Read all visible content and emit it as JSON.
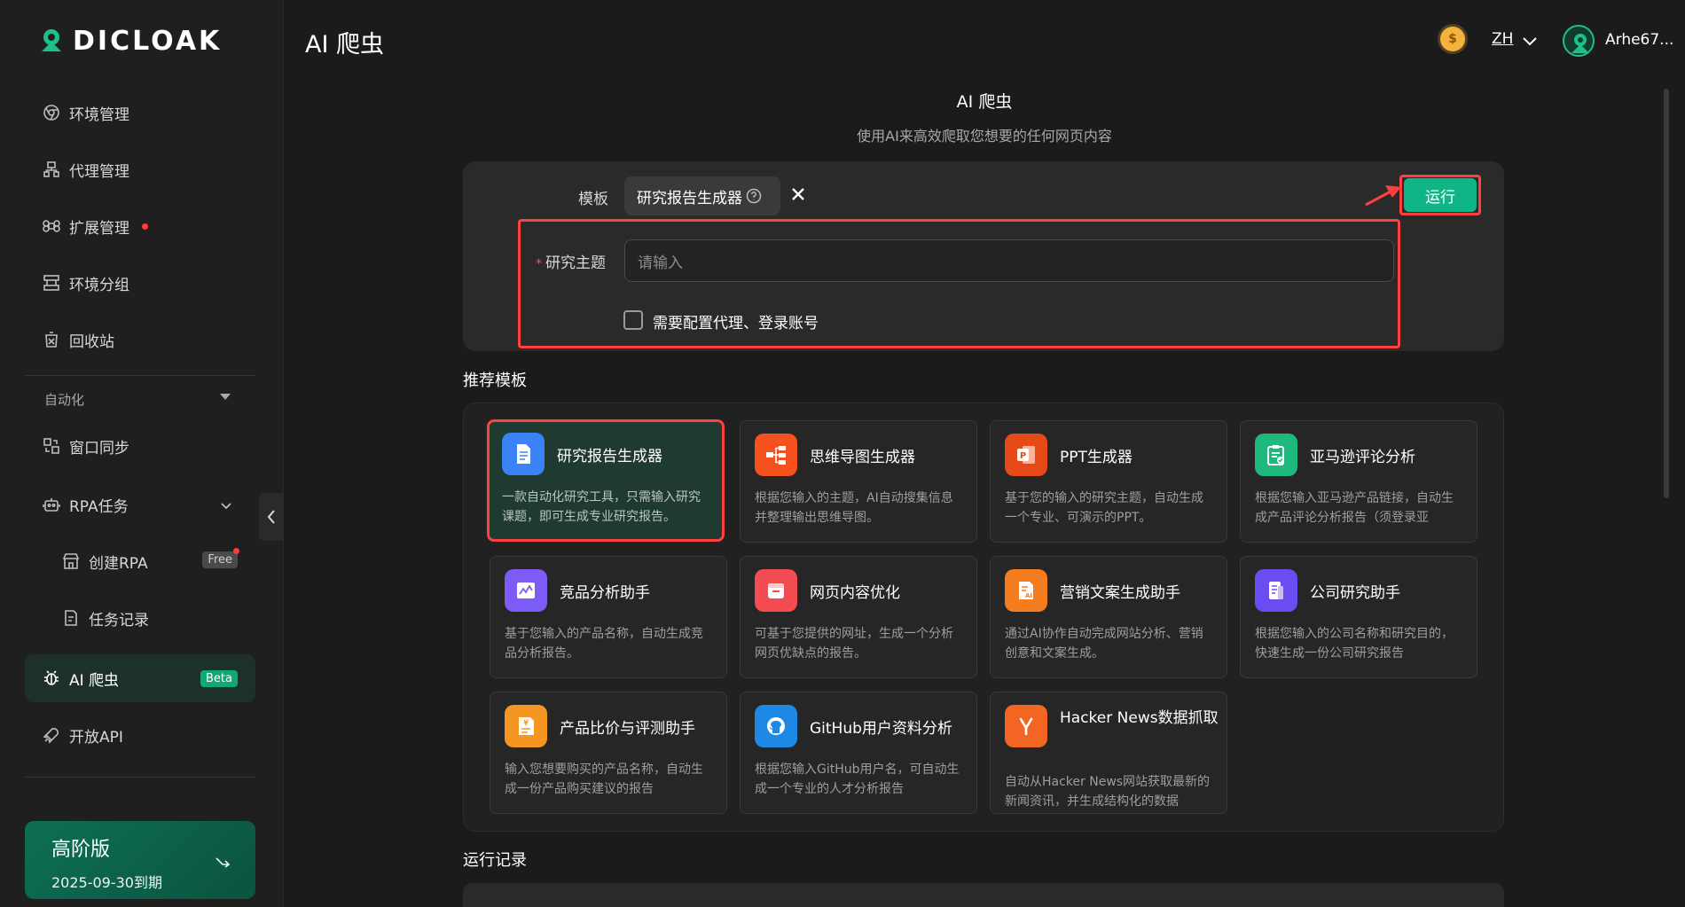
{
  "brand": {
    "name": "DICLOAK"
  },
  "sidebar": {
    "items": [
      {
        "label": "环境管理",
        "icon": "chrome-icon"
      },
      {
        "label": "代理管理",
        "icon": "proxy-icon"
      },
      {
        "label": "扩展管理",
        "icon": "command-icon"
      },
      {
        "label": "环境分组",
        "icon": "group-icon"
      },
      {
        "label": "回收站",
        "icon": "trash-icon"
      }
    ],
    "automation_title": "自动化",
    "auto_items": [
      {
        "label": "窗口同步",
        "icon": "sync-icon"
      },
      {
        "label": "RPA任务",
        "icon": "robot-icon"
      },
      {
        "label": "创建RPA",
        "icon": "store-icon",
        "badge": "Free"
      },
      {
        "label": "任务记录",
        "icon": "record-icon"
      },
      {
        "label": "AI 爬虫",
        "icon": "bug-icon",
        "badge": "Beta"
      },
      {
        "label": "开放API",
        "icon": "rocket-icon"
      }
    ],
    "plan": {
      "title": "高阶版",
      "expiry": "2025-09-30到期"
    }
  },
  "header": {
    "title": "AI 爬虫",
    "language": "ZH",
    "username": "Arhe67..."
  },
  "main": {
    "heading": "AI 爬虫",
    "subheading": "使用AI来高效爬取您想要的任何网页内容",
    "form": {
      "template_label": "模板",
      "template_value": "研究报告生成器",
      "run_label": "运行",
      "topic_label": "研究主题",
      "topic_placeholder": "请输入",
      "proxy_checkbox_label": "需要配置代理、登录账号"
    },
    "recommended_title": "推荐模板",
    "templates": [
      {
        "title": "研究报告生成器",
        "desc": "一款自动化研究工具，只需输入研究课题，即可生成专业研究报告。",
        "icon": "document-icon",
        "color": "#3b82f6"
      },
      {
        "title": "思维导图生成器",
        "desc": "根据您输入的主题，AI自动搜集信息并整理输出思维导图。",
        "icon": "mindmap-icon",
        "color": "#f4511e"
      },
      {
        "title": "PPT生成器",
        "desc": "基于您的输入的研究主题，自动生成一个专业、可演示的PPT。",
        "icon": "ppt-icon",
        "color": "#e64a19"
      },
      {
        "title": "亚马逊评论分析",
        "desc": "根据您输入亚马逊产品链接，自动生成产品评论分析报告（须登录亚",
        "icon": "clipboard-icon",
        "color": "#1fb980"
      },
      {
        "title": "竞品分析助手",
        "desc": "基于您输入的产品名称，自动生成竞品分析报告。",
        "icon": "chart-icon",
        "color": "#7c5cf4"
      },
      {
        "title": "网页内容优化",
        "desc": "可基于您提供的网址，生成一个分析网页优缺点的报告。",
        "icon": "browser-icon",
        "color": "#f24b52"
      },
      {
        "title": "营销文案生成助手",
        "desc": "通过AI协作自动完成网站分析、营销创意和文案生成。",
        "icon": "ai-doc-icon",
        "color": "#f57c1f"
      },
      {
        "title": "公司研究助手",
        "desc": "根据您输入的公司名称和研究目的，快速生成一份公司研究报告",
        "icon": "report-icon",
        "color": "#6a4cf0"
      },
      {
        "title": "产品比价与评测助手",
        "desc": "输入您想要购买的产品名称，自动生成一份产品购买建议的报告",
        "icon": "price-icon",
        "color": "#f59622"
      },
      {
        "title": "GitHub用户资料分析",
        "desc": "根据您输入GitHub用户名，可自动生成一个专业的人才分析报告",
        "icon": "github-icon",
        "color": "#1e88e5"
      },
      {
        "title": "Hacker News数据抓取",
        "desc": "自动从Hacker News网站获取最新的新闻资讯，并生成结构化的数据",
        "icon": "hackernews-icon",
        "color": "#f26522"
      }
    ],
    "run_log_title": "运行记录"
  },
  "colors": {
    "accent": "#10b585",
    "highlight": "#ff4040",
    "background": "#1b1b1b"
  }
}
